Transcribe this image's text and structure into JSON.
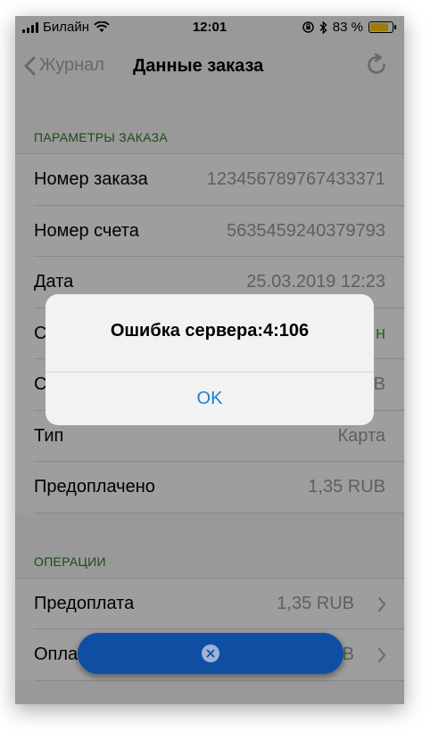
{
  "status_bar": {
    "carrier": "Билайн",
    "time": "12:01",
    "battery_percent": "83 %",
    "battery_level": 0.83,
    "battery_color": "#ffcc00"
  },
  "nav": {
    "back_label": "Журнал",
    "title": "Данные заказа",
    "icons": {
      "back": "chevron-left-icon",
      "refresh": "refresh-icon"
    }
  },
  "sections": {
    "params": {
      "header": "ПАРАМЕТРЫ ЗАКАЗА",
      "rows": [
        {
          "label": "Номер заказа",
          "value": "123456789767433371"
        },
        {
          "label": "Номер счета",
          "value": "5635459240379793"
        },
        {
          "label": "Дата",
          "value": "25.03.2019 12:23"
        },
        {
          "label": "С",
          "value": "н"
        },
        {
          "label": "С",
          "value": "В"
        },
        {
          "label": "Тип",
          "value": "Карта"
        },
        {
          "label": "Предоплачено",
          "value": "1,35 RUB"
        }
      ]
    },
    "operations": {
      "header": "ОПЕРАЦИИ",
      "rows": [
        {
          "label": "Предоплата",
          "value": "1,35 RUB"
        },
        {
          "label": "Опла",
          "value": "В"
        }
      ]
    }
  },
  "alert": {
    "message": "Ошибка сервера:4:106",
    "button": "OK"
  },
  "colors": {
    "accent": "#1c7ed6",
    "section_header": "#2d7a2d",
    "status_green": "#35b33a",
    "pill": "#0f4fa3"
  }
}
